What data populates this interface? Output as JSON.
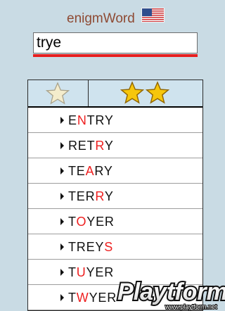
{
  "app": {
    "title": "enigmWord",
    "flag_icon": "us-flag-icon"
  },
  "search": {
    "value": "trye",
    "placeholder": ""
  },
  "tabs": [
    {
      "name": "single-star",
      "stars": 1,
      "active": false,
      "icon": "star-icon"
    },
    {
      "name": "double-star",
      "stars": 2,
      "active": true,
      "icon": "star-icon"
    }
  ],
  "results": [
    {
      "prefix": "E",
      "highlight": "N",
      "suffix": "TRY"
    },
    {
      "prefix": "RET",
      "highlight": "R",
      "suffix": "Y"
    },
    {
      "prefix": "TE",
      "highlight": "A",
      "suffix": "RY"
    },
    {
      "prefix": "TER",
      "highlight": "R",
      "suffix": "Y"
    },
    {
      "prefix": "T",
      "highlight": "O",
      "suffix": "YER"
    },
    {
      "prefix": "TREY",
      "highlight": "S",
      "suffix": ""
    },
    {
      "prefix": "T",
      "highlight": "U",
      "suffix": "YER"
    },
    {
      "prefix": "T",
      "highlight": "W",
      "suffix": "YER"
    }
  ],
  "watermark": {
    "brand": "Playtform",
    "url": "www.playtform.net"
  },
  "colors": {
    "background": "#c9dbe4",
    "title": "#8e4a33",
    "accent": "#e71e1e",
    "highlight": "#ee1f1f",
    "star_gold": "#f2c411",
    "star_pale": "#efe7c4"
  }
}
